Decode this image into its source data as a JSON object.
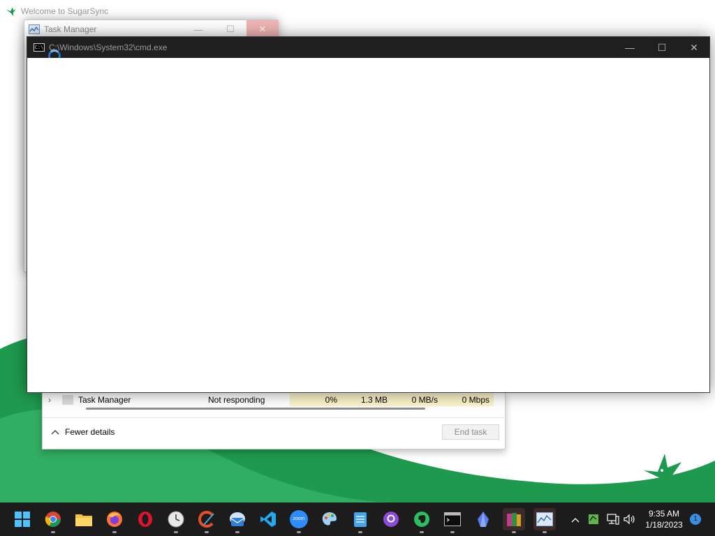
{
  "desktop": {
    "sugarsync_title": "Welcome to SugarSync"
  },
  "task_manager": {
    "title": "Task Manager",
    "controls": {
      "minimize": "—",
      "maximize": "☐",
      "close": "✕"
    },
    "row": {
      "expander": "›",
      "name": "Task Manager",
      "status": "Not responding",
      "cpu": "0%",
      "memory": "1.3 MB",
      "disk": "0 MB/s",
      "network": "0 Mbps"
    },
    "fewer_details_label": "Fewer details",
    "end_task_label": "End task"
  },
  "cmd_window": {
    "title": "C:\\Windows\\System32\\cmd.exe",
    "icon_label": "C:\\",
    "controls": {
      "minimize": "—",
      "maximize": "☐",
      "close": "✕"
    }
  },
  "taskbar": {
    "apps": [
      {
        "name": "start-icon"
      },
      {
        "name": "chrome-icon"
      },
      {
        "name": "file-explorer-icon"
      },
      {
        "name": "firefox-icon"
      },
      {
        "name": "opera-icon"
      },
      {
        "name": "clock-app-icon"
      },
      {
        "name": "ccleaner-icon"
      },
      {
        "name": "mail-app-icon"
      },
      {
        "name": "vscode-icon"
      },
      {
        "name": "zoom-icon",
        "label": "zoom"
      },
      {
        "name": "paint-icon"
      },
      {
        "name": "notepad-icon"
      },
      {
        "name": "github-icon"
      },
      {
        "name": "evernote-icon"
      },
      {
        "name": "cmd-icon"
      },
      {
        "name": "crystal-app-icon"
      },
      {
        "name": "winrar-icon"
      },
      {
        "name": "task-manager-icon"
      }
    ],
    "clock": {
      "time": "9:35 AM",
      "date": "1/18/2023"
    },
    "notification_count": "1"
  },
  "colors": {
    "sugarsync_green": "#1e9a4e",
    "cmd_titlebar": "#1f1f1f",
    "taskbar": "#1c1c1c",
    "accent_blue": "#3b8ee0"
  }
}
